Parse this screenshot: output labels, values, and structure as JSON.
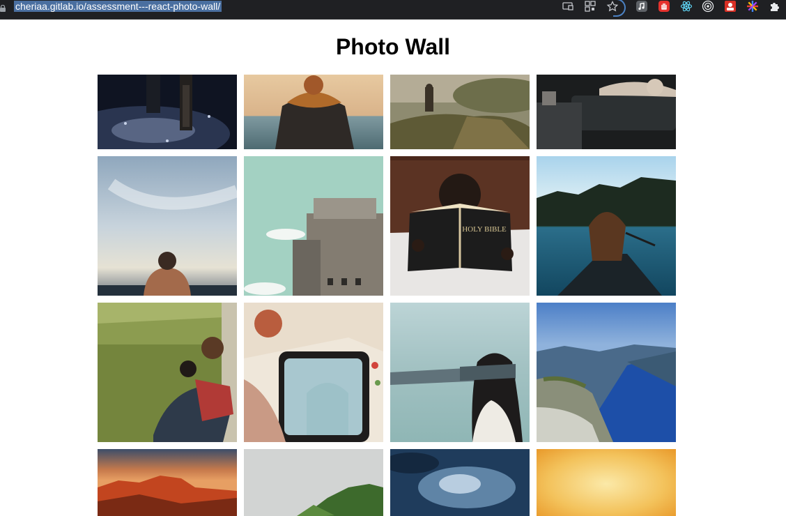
{
  "browser": {
    "url": "cheriaa.gitlab.io/assessment---react-photo-wall/",
    "icons": [
      "lock-icon",
      "cast-icon",
      "qr-code-icon",
      "bookmark-star-icon"
    ],
    "extensions": [
      "music-extension-icon",
      "hand-extension-icon",
      "react-devtools-icon",
      "target-extension-icon",
      "red-extension-icon",
      "star-burst-extension-icon",
      "puzzle-extensions-icon"
    ]
  },
  "page": {
    "title": "Photo Wall"
  },
  "photos": [
    {
      "name": "photo-wet-path-legs"
    },
    {
      "name": "photo-jacket-person-sea"
    },
    {
      "name": "photo-person-on-cliff-fog"
    },
    {
      "name": "photo-woman-resting-couch"
    },
    {
      "name": "photo-man-looking-at-sky"
    },
    {
      "name": "photo-concrete-bunker"
    },
    {
      "name": "photo-child-reading-bible",
      "caption": "HOLY BIBLE"
    },
    {
      "name": "photo-woman-in-canoe-lake"
    },
    {
      "name": "photo-couple-in-grass"
    },
    {
      "name": "photo-couple-in-van"
    },
    {
      "name": "photo-blindfolded-woman-sea"
    },
    {
      "name": "photo-fjord-cliff"
    },
    {
      "name": "photo-red-mountain-sunset"
    },
    {
      "name": "photo-green-hills-fog"
    },
    {
      "name": "photo-stormy-blue-sky"
    },
    {
      "name": "photo-golden-haze"
    }
  ]
}
